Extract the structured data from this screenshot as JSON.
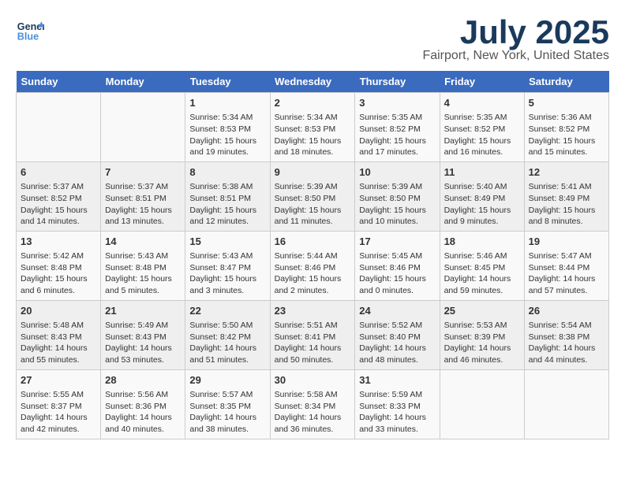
{
  "header": {
    "logo_line1": "General",
    "logo_line2": "Blue",
    "title": "July 2025",
    "subtitle": "Fairport, New York, United States"
  },
  "weekdays": [
    "Sunday",
    "Monday",
    "Tuesday",
    "Wednesday",
    "Thursday",
    "Friday",
    "Saturday"
  ],
  "weeks": [
    [
      {
        "day": "",
        "sunrise": "",
        "sunset": "",
        "daylight": ""
      },
      {
        "day": "",
        "sunrise": "",
        "sunset": "",
        "daylight": ""
      },
      {
        "day": "1",
        "sunrise": "Sunrise: 5:34 AM",
        "sunset": "Sunset: 8:53 PM",
        "daylight": "Daylight: 15 hours and 19 minutes."
      },
      {
        "day": "2",
        "sunrise": "Sunrise: 5:34 AM",
        "sunset": "Sunset: 8:53 PM",
        "daylight": "Daylight: 15 hours and 18 minutes."
      },
      {
        "day": "3",
        "sunrise": "Sunrise: 5:35 AM",
        "sunset": "Sunset: 8:52 PM",
        "daylight": "Daylight: 15 hours and 17 minutes."
      },
      {
        "day": "4",
        "sunrise": "Sunrise: 5:35 AM",
        "sunset": "Sunset: 8:52 PM",
        "daylight": "Daylight: 15 hours and 16 minutes."
      },
      {
        "day": "5",
        "sunrise": "Sunrise: 5:36 AM",
        "sunset": "Sunset: 8:52 PM",
        "daylight": "Daylight: 15 hours and 15 minutes."
      }
    ],
    [
      {
        "day": "6",
        "sunrise": "Sunrise: 5:37 AM",
        "sunset": "Sunset: 8:52 PM",
        "daylight": "Daylight: 15 hours and 14 minutes."
      },
      {
        "day": "7",
        "sunrise": "Sunrise: 5:37 AM",
        "sunset": "Sunset: 8:51 PM",
        "daylight": "Daylight: 15 hours and 13 minutes."
      },
      {
        "day": "8",
        "sunrise": "Sunrise: 5:38 AM",
        "sunset": "Sunset: 8:51 PM",
        "daylight": "Daylight: 15 hours and 12 minutes."
      },
      {
        "day": "9",
        "sunrise": "Sunrise: 5:39 AM",
        "sunset": "Sunset: 8:50 PM",
        "daylight": "Daylight: 15 hours and 11 minutes."
      },
      {
        "day": "10",
        "sunrise": "Sunrise: 5:39 AM",
        "sunset": "Sunset: 8:50 PM",
        "daylight": "Daylight: 15 hours and 10 minutes."
      },
      {
        "day": "11",
        "sunrise": "Sunrise: 5:40 AM",
        "sunset": "Sunset: 8:49 PM",
        "daylight": "Daylight: 15 hours and 9 minutes."
      },
      {
        "day": "12",
        "sunrise": "Sunrise: 5:41 AM",
        "sunset": "Sunset: 8:49 PM",
        "daylight": "Daylight: 15 hours and 8 minutes."
      }
    ],
    [
      {
        "day": "13",
        "sunrise": "Sunrise: 5:42 AM",
        "sunset": "Sunset: 8:48 PM",
        "daylight": "Daylight: 15 hours and 6 minutes."
      },
      {
        "day": "14",
        "sunrise": "Sunrise: 5:43 AM",
        "sunset": "Sunset: 8:48 PM",
        "daylight": "Daylight: 15 hours and 5 minutes."
      },
      {
        "day": "15",
        "sunrise": "Sunrise: 5:43 AM",
        "sunset": "Sunset: 8:47 PM",
        "daylight": "Daylight: 15 hours and 3 minutes."
      },
      {
        "day": "16",
        "sunrise": "Sunrise: 5:44 AM",
        "sunset": "Sunset: 8:46 PM",
        "daylight": "Daylight: 15 hours and 2 minutes."
      },
      {
        "day": "17",
        "sunrise": "Sunrise: 5:45 AM",
        "sunset": "Sunset: 8:46 PM",
        "daylight": "Daylight: 15 hours and 0 minutes."
      },
      {
        "day": "18",
        "sunrise": "Sunrise: 5:46 AM",
        "sunset": "Sunset: 8:45 PM",
        "daylight": "Daylight: 14 hours and 59 minutes."
      },
      {
        "day": "19",
        "sunrise": "Sunrise: 5:47 AM",
        "sunset": "Sunset: 8:44 PM",
        "daylight": "Daylight: 14 hours and 57 minutes."
      }
    ],
    [
      {
        "day": "20",
        "sunrise": "Sunrise: 5:48 AM",
        "sunset": "Sunset: 8:43 PM",
        "daylight": "Daylight: 14 hours and 55 minutes."
      },
      {
        "day": "21",
        "sunrise": "Sunrise: 5:49 AM",
        "sunset": "Sunset: 8:43 PM",
        "daylight": "Daylight: 14 hours and 53 minutes."
      },
      {
        "day": "22",
        "sunrise": "Sunrise: 5:50 AM",
        "sunset": "Sunset: 8:42 PM",
        "daylight": "Daylight: 14 hours and 51 minutes."
      },
      {
        "day": "23",
        "sunrise": "Sunrise: 5:51 AM",
        "sunset": "Sunset: 8:41 PM",
        "daylight": "Daylight: 14 hours and 50 minutes."
      },
      {
        "day": "24",
        "sunrise": "Sunrise: 5:52 AM",
        "sunset": "Sunset: 8:40 PM",
        "daylight": "Daylight: 14 hours and 48 minutes."
      },
      {
        "day": "25",
        "sunrise": "Sunrise: 5:53 AM",
        "sunset": "Sunset: 8:39 PM",
        "daylight": "Daylight: 14 hours and 46 minutes."
      },
      {
        "day": "26",
        "sunrise": "Sunrise: 5:54 AM",
        "sunset": "Sunset: 8:38 PM",
        "daylight": "Daylight: 14 hours and 44 minutes."
      }
    ],
    [
      {
        "day": "27",
        "sunrise": "Sunrise: 5:55 AM",
        "sunset": "Sunset: 8:37 PM",
        "daylight": "Daylight: 14 hours and 42 minutes."
      },
      {
        "day": "28",
        "sunrise": "Sunrise: 5:56 AM",
        "sunset": "Sunset: 8:36 PM",
        "daylight": "Daylight: 14 hours and 40 minutes."
      },
      {
        "day": "29",
        "sunrise": "Sunrise: 5:57 AM",
        "sunset": "Sunset: 8:35 PM",
        "daylight": "Daylight: 14 hours and 38 minutes."
      },
      {
        "day": "30",
        "sunrise": "Sunrise: 5:58 AM",
        "sunset": "Sunset: 8:34 PM",
        "daylight": "Daylight: 14 hours and 36 minutes."
      },
      {
        "day": "31",
        "sunrise": "Sunrise: 5:59 AM",
        "sunset": "Sunset: 8:33 PM",
        "daylight": "Daylight: 14 hours and 33 minutes."
      },
      {
        "day": "",
        "sunrise": "",
        "sunset": "",
        "daylight": ""
      },
      {
        "day": "",
        "sunrise": "",
        "sunset": "",
        "daylight": ""
      }
    ]
  ]
}
